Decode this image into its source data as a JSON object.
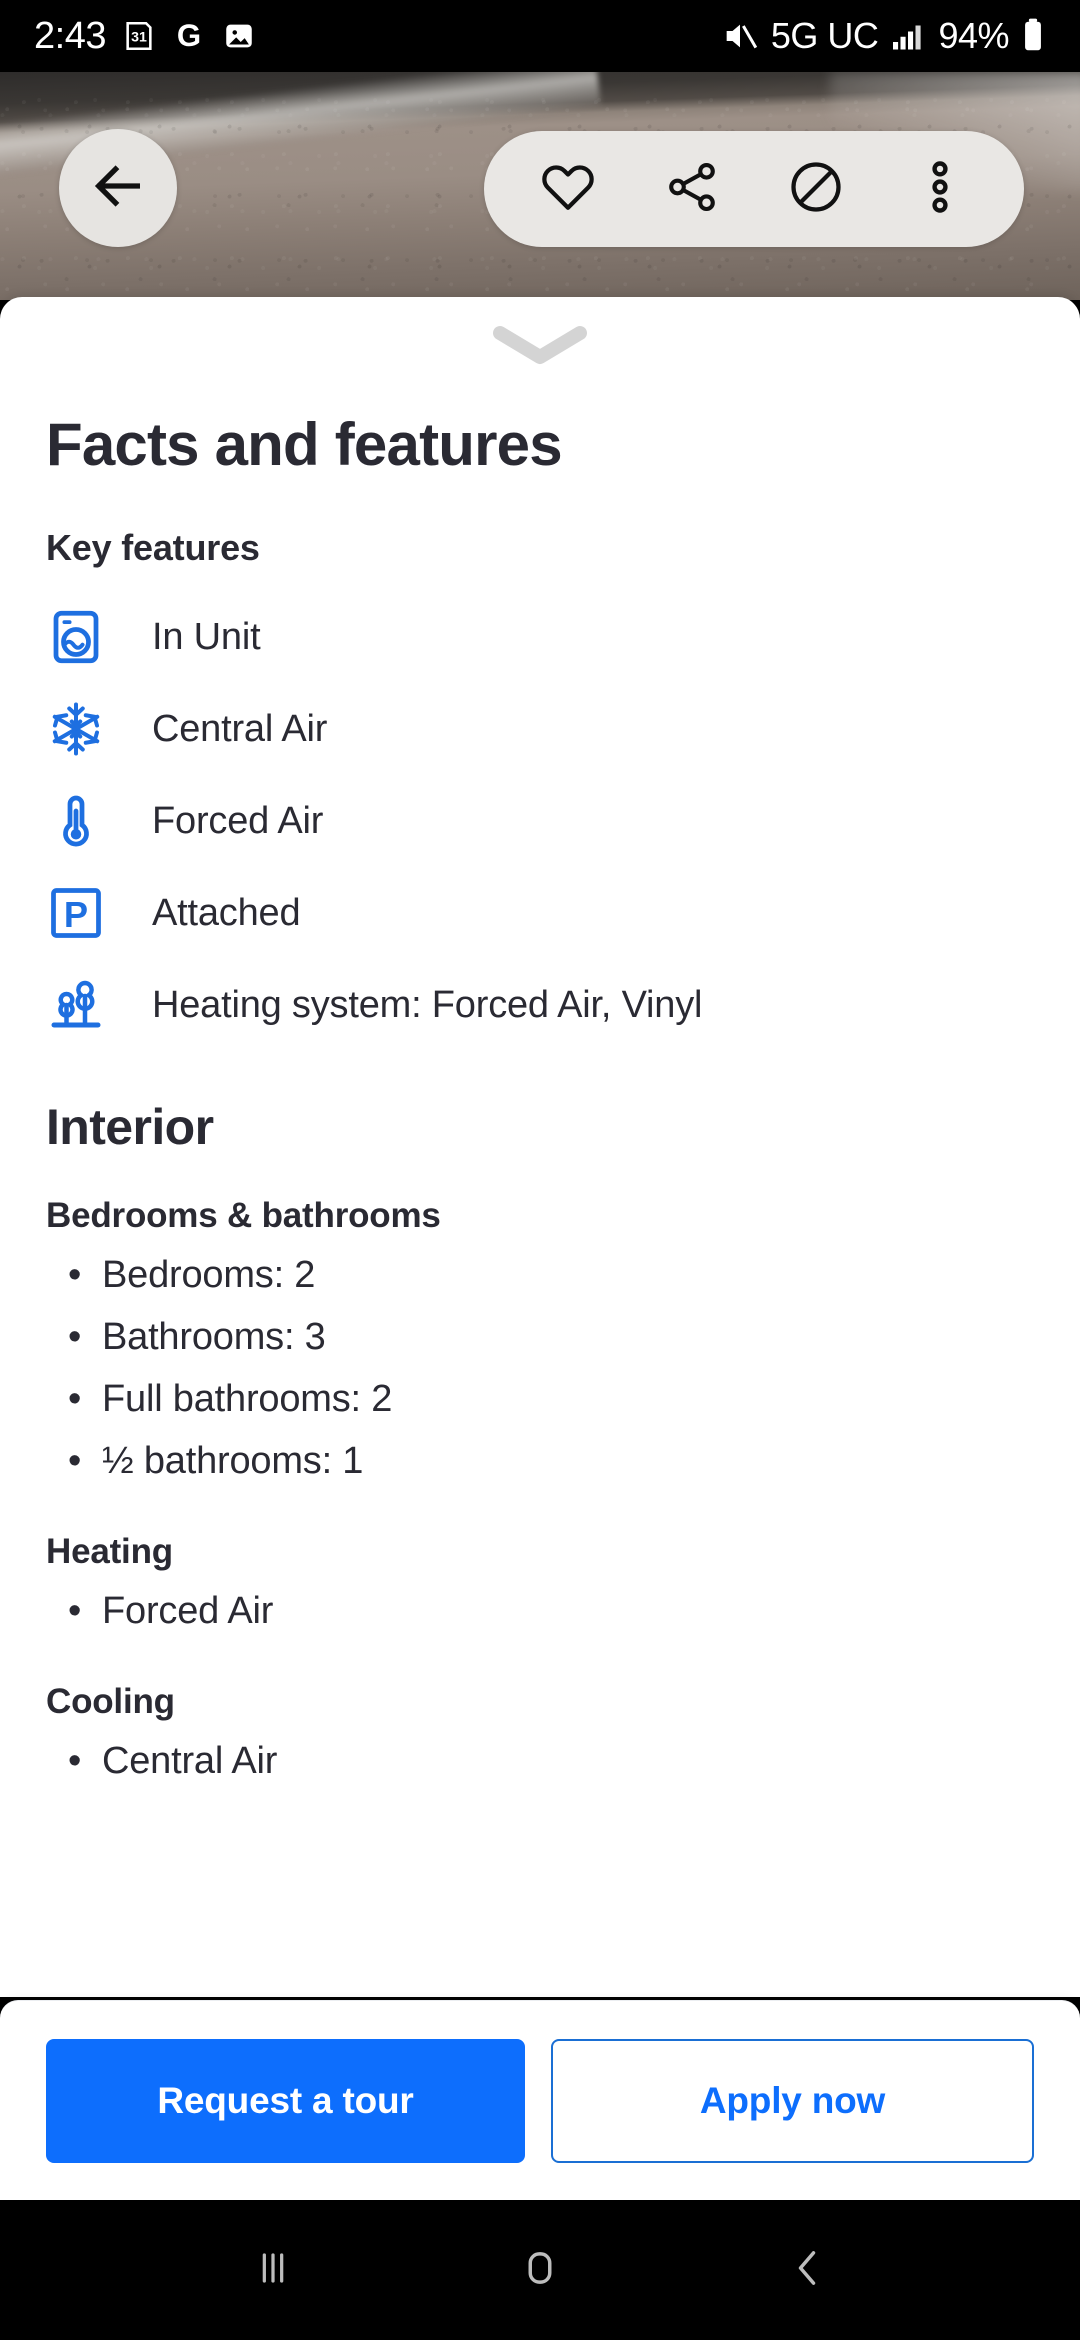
{
  "status_bar": {
    "time": "2:43",
    "left_icons": [
      "calendar-31-icon",
      "google-g-icon",
      "photos-icon"
    ],
    "mute_icon": "volume-mute-icon",
    "network": "5G UC",
    "signal_icon": "signal-bars-icon",
    "battery_percent": "94%",
    "battery_icon": "battery-icon"
  },
  "hero": {
    "back_icon": "arrow-left-icon",
    "actions": [
      {
        "name": "favorite-button",
        "icon": "heart-icon"
      },
      {
        "name": "share-button",
        "icon": "share-icon"
      },
      {
        "name": "hide-listing-button",
        "icon": "block-circle-slash-icon"
      },
      {
        "name": "more-options-button",
        "icon": "overflow-menu-icon"
      }
    ]
  },
  "sheet": {
    "grabber_icon": "chevron-down-icon",
    "title": "Facts and features",
    "key_features": {
      "heading": "Key features",
      "items": [
        {
          "icon": "washer-dryer-icon",
          "label": "In Unit"
        },
        {
          "icon": "snowflake-icon",
          "label": "Central Air"
        },
        {
          "icon": "thermometer-icon",
          "label": "Forced Air"
        },
        {
          "icon": "parking-p-icon",
          "label": "Attached"
        },
        {
          "icon": "trees-landscape-icon",
          "label": "Heating system: Forced Air, Vinyl"
        }
      ]
    },
    "interior": {
      "heading": "Interior",
      "sections": [
        {
          "heading": "Bedrooms & bathrooms",
          "bullets": [
            "Bedrooms: 2",
            "Bathrooms: 3",
            "Full bathrooms: 2",
            "½ bathrooms: 1"
          ]
        },
        {
          "heading": "Heating",
          "bullets": [
            "Forced Air"
          ]
        },
        {
          "heading": "Cooling",
          "bullets": [
            "Central Air"
          ]
        }
      ]
    }
  },
  "cta": {
    "primary_label": "Request a tour",
    "secondary_label": "Apply now"
  },
  "android_nav": {
    "recents_icon": "recents-icon",
    "home_icon": "home-icon",
    "back_icon": "back-chevron-icon"
  },
  "colors": {
    "accent_blue": "#0d6efd",
    "icon_blue": "#1e6fe0",
    "text_dark": "#2a2a33",
    "sheet_bg": "#ffffff",
    "system_black": "#000000"
  },
  "bullet_glyph": "•"
}
